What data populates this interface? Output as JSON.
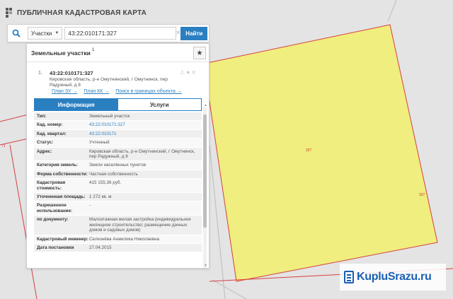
{
  "header": {
    "title": "ПУБЛИЧНАЯ КАДАСТРОВАЯ КАРТА"
  },
  "search": {
    "type_label": "Участки",
    "value": "43:22:010171:327",
    "button_label": "Найти"
  },
  "panel": {
    "title": "Земельные участки",
    "count": "1",
    "result": {
      "index": "1.",
      "cad_number": "43:22:010171:327",
      "address": "Кировская область, р-н Омутнинский, г Омутнинск, пер Радужный, д 8",
      "links": [
        "План ЗУ →",
        "План КК →",
        "Поиск в границах объекта →"
      ],
      "tabs": {
        "info": "Информация",
        "services": "Услуги"
      },
      "rows": [
        {
          "k": "Тип:",
          "v": "Земельный участок"
        },
        {
          "k": "Кад. номер:",
          "v": "43:22:010171:327",
          "link": true
        },
        {
          "k": "Кад. квартал:",
          "v": "43:22:010171",
          "link": true
        },
        {
          "k": "Статус:",
          "v": "Учтенный"
        },
        {
          "k": "Адрес:",
          "v": "Кировская область, р-н Омутнинский, г Омутнинск, пер Радужный, д 8"
        },
        {
          "k": "Категория земель:",
          "v": "Земли населённых пунктов"
        },
        {
          "k": "Форма собственности:",
          "v": "Частная собственность"
        },
        {
          "k": "Кадастровая стоимость:",
          "v": "415 155,36 руб."
        },
        {
          "k": "Уточненная площадь:",
          "v": "1 272 кв. м"
        },
        {
          "k": "Разрешенное использование:",
          "v": "-"
        },
        {
          "k": "по документу:",
          "v": "Малоэтажная жилая застройка (индивидуальное жилищное строительство; размещение дачных домов и садовых домов)"
        },
        {
          "k": "Кадастровый инженер:",
          "v": "Селезнёва Анжелика Николаевна"
        },
        {
          "k": "Дата постановки",
          "v": "27.04.2015"
        }
      ]
    }
  },
  "map": {
    "parcel_fill": "#f0ee7e",
    "boundary_color": "#d64040",
    "labels": {
      "parcel_center": "327",
      "parcel_edge": "327",
      "left_edge": "71"
    }
  },
  "watermark": {
    "text": "KupluSrazu.ru"
  }
}
